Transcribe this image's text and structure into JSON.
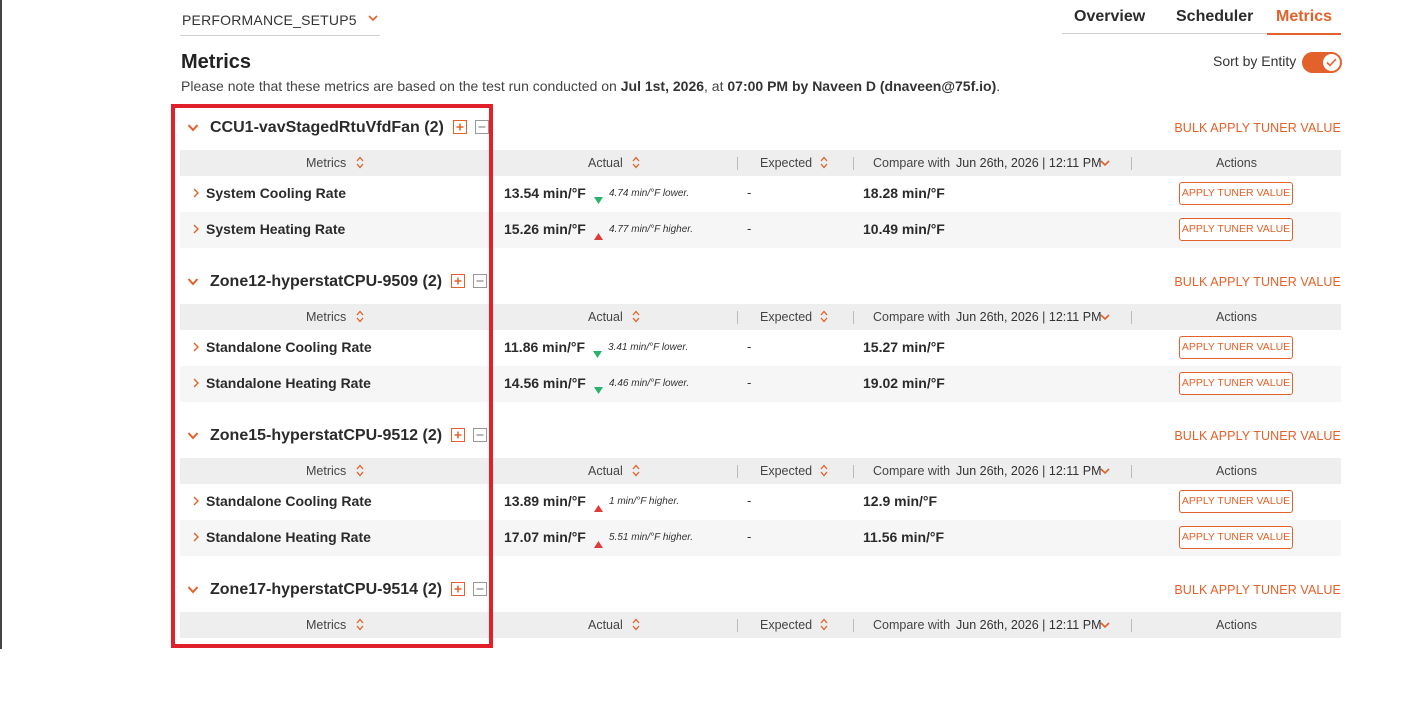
{
  "setup": {
    "selected": "PERFORMANCE_SETUP5"
  },
  "tabs": [
    {
      "label": "Overview",
      "active": false
    },
    {
      "label": "Scheduler",
      "active": false
    },
    {
      "label": "Metrics",
      "active": true
    }
  ],
  "page": {
    "title": "Metrics",
    "note_prefix": "Please note that these metrics are based on the test run conducted on ",
    "note_date": "Jul 1st, 2026",
    "note_mid": ", at ",
    "note_time": "07:00 PM by Naveen D",
    "note_email": " (dnaveen@75f.io)",
    "note_end": "."
  },
  "sort": {
    "label": "Sort by Entity",
    "on": true
  },
  "colors": {
    "accent": "#e3612a",
    "up": "#e03a3a",
    "down": "#2ab36a",
    "highlight": "#e0202a"
  },
  "table_headers": {
    "metrics": "Metrics",
    "actual": "Actual",
    "expected": "Expected",
    "compare_with": "Compare with",
    "compare_value": "Jun 26th, 2026 | 12:11 PM",
    "actions": "Actions"
  },
  "bulk_label": "BULK APPLY TUNER VALUE",
  "apply_label": "APPLY TUNER VALUE",
  "groups": [
    {
      "name": "CCU1-vavStagedRtuVfdFan (2)",
      "rows": [
        {
          "name": "System Cooling Rate",
          "actual": "13.54 min/°F",
          "direction": "down",
          "delta": "4.74 min/°F lower.",
          "expected": "-",
          "compare": "18.28 min/°F"
        },
        {
          "name": "System Heating Rate",
          "actual": "15.26 min/°F",
          "direction": "up",
          "delta": "4.77 min/°F higher.",
          "expected": "-",
          "compare": "10.49 min/°F"
        }
      ]
    },
    {
      "name": "Zone12-hyperstatCPU-9509 (2)",
      "rows": [
        {
          "name": "Standalone Cooling Rate",
          "actual": "11.86 min/°F",
          "direction": "down",
          "delta": "3.41 min/°F lower.",
          "expected": "-",
          "compare": "15.27 min/°F"
        },
        {
          "name": "Standalone Heating Rate",
          "actual": "14.56 min/°F",
          "direction": "down",
          "delta": "4.46 min/°F lower.",
          "expected": "-",
          "compare": "19.02 min/°F"
        }
      ]
    },
    {
      "name": "Zone15-hyperstatCPU-9512 (2)",
      "rows": [
        {
          "name": "Standalone Cooling Rate",
          "actual": "13.89 min/°F",
          "direction": "up",
          "delta": "1 min/°F higher.",
          "expected": "-",
          "compare": "12.9 min/°F"
        },
        {
          "name": "Standalone Heating Rate",
          "actual": "17.07 min/°F",
          "direction": "up",
          "delta": "5.51 min/°F higher.",
          "expected": "-",
          "compare": "11.56 min/°F"
        }
      ]
    },
    {
      "name": "Zone17-hyperstatCPU-9514 (2)",
      "rows": []
    }
  ]
}
